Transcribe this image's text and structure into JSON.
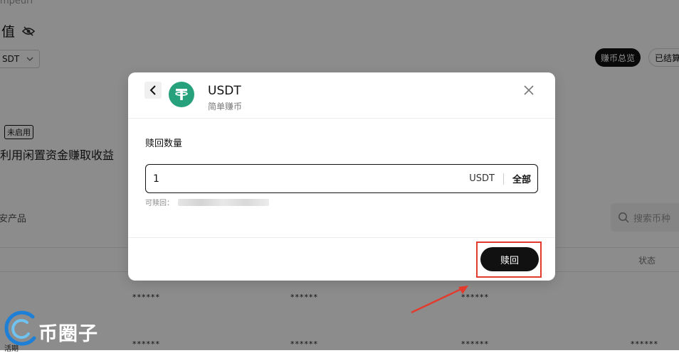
{
  "background": {
    "crumb": "mpeuri",
    "title": "值",
    "currency_select": "SDT",
    "pill_total": "赚币总览",
    "pill_settled": "已结算",
    "badge": "未启用",
    "earn_text": "利用闲置资金赚取收益",
    "products_label": "安产品",
    "search_placeholder": "搜索币种",
    "status_header": "状态",
    "masked": "******",
    "row_link": "活期"
  },
  "modal": {
    "coin_name": "USDT",
    "coin_subtitle": "简单赚币",
    "field_label": "赎回数量",
    "amount_value": "1",
    "unit": "USDT",
    "max_label": "全部",
    "available_label": "可赎回：",
    "redeem_label": "赎回"
  },
  "watermark": {
    "text": "币圈子"
  },
  "colors": {
    "tether_green": "#26a17b",
    "primary_black": "#111111",
    "highlight_red": "#e23b2e",
    "watermark_blue": "#1e7fd6"
  }
}
